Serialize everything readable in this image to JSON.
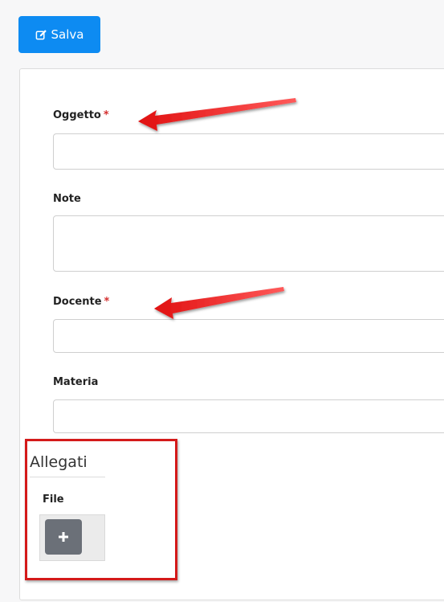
{
  "toolbar": {
    "save_label": "Salva",
    "save_icon": "pencil-square-icon"
  },
  "form": {
    "fields": [
      {
        "label": "Oggetto",
        "required": true,
        "value": ""
      },
      {
        "label": "Note",
        "required": false,
        "value": ""
      },
      {
        "label": "Docente",
        "required": true,
        "value": ""
      },
      {
        "label": "Materia",
        "required": false,
        "value": ""
      }
    ],
    "required_marker": "*"
  },
  "attachments": {
    "title": "Allegati",
    "file_label": "File",
    "add_icon": "plus-icon"
  },
  "colors": {
    "primary": "#0d8bf2",
    "required": "#d43030",
    "annotation": "#d41a1a",
    "add_button": "#6b7078"
  }
}
